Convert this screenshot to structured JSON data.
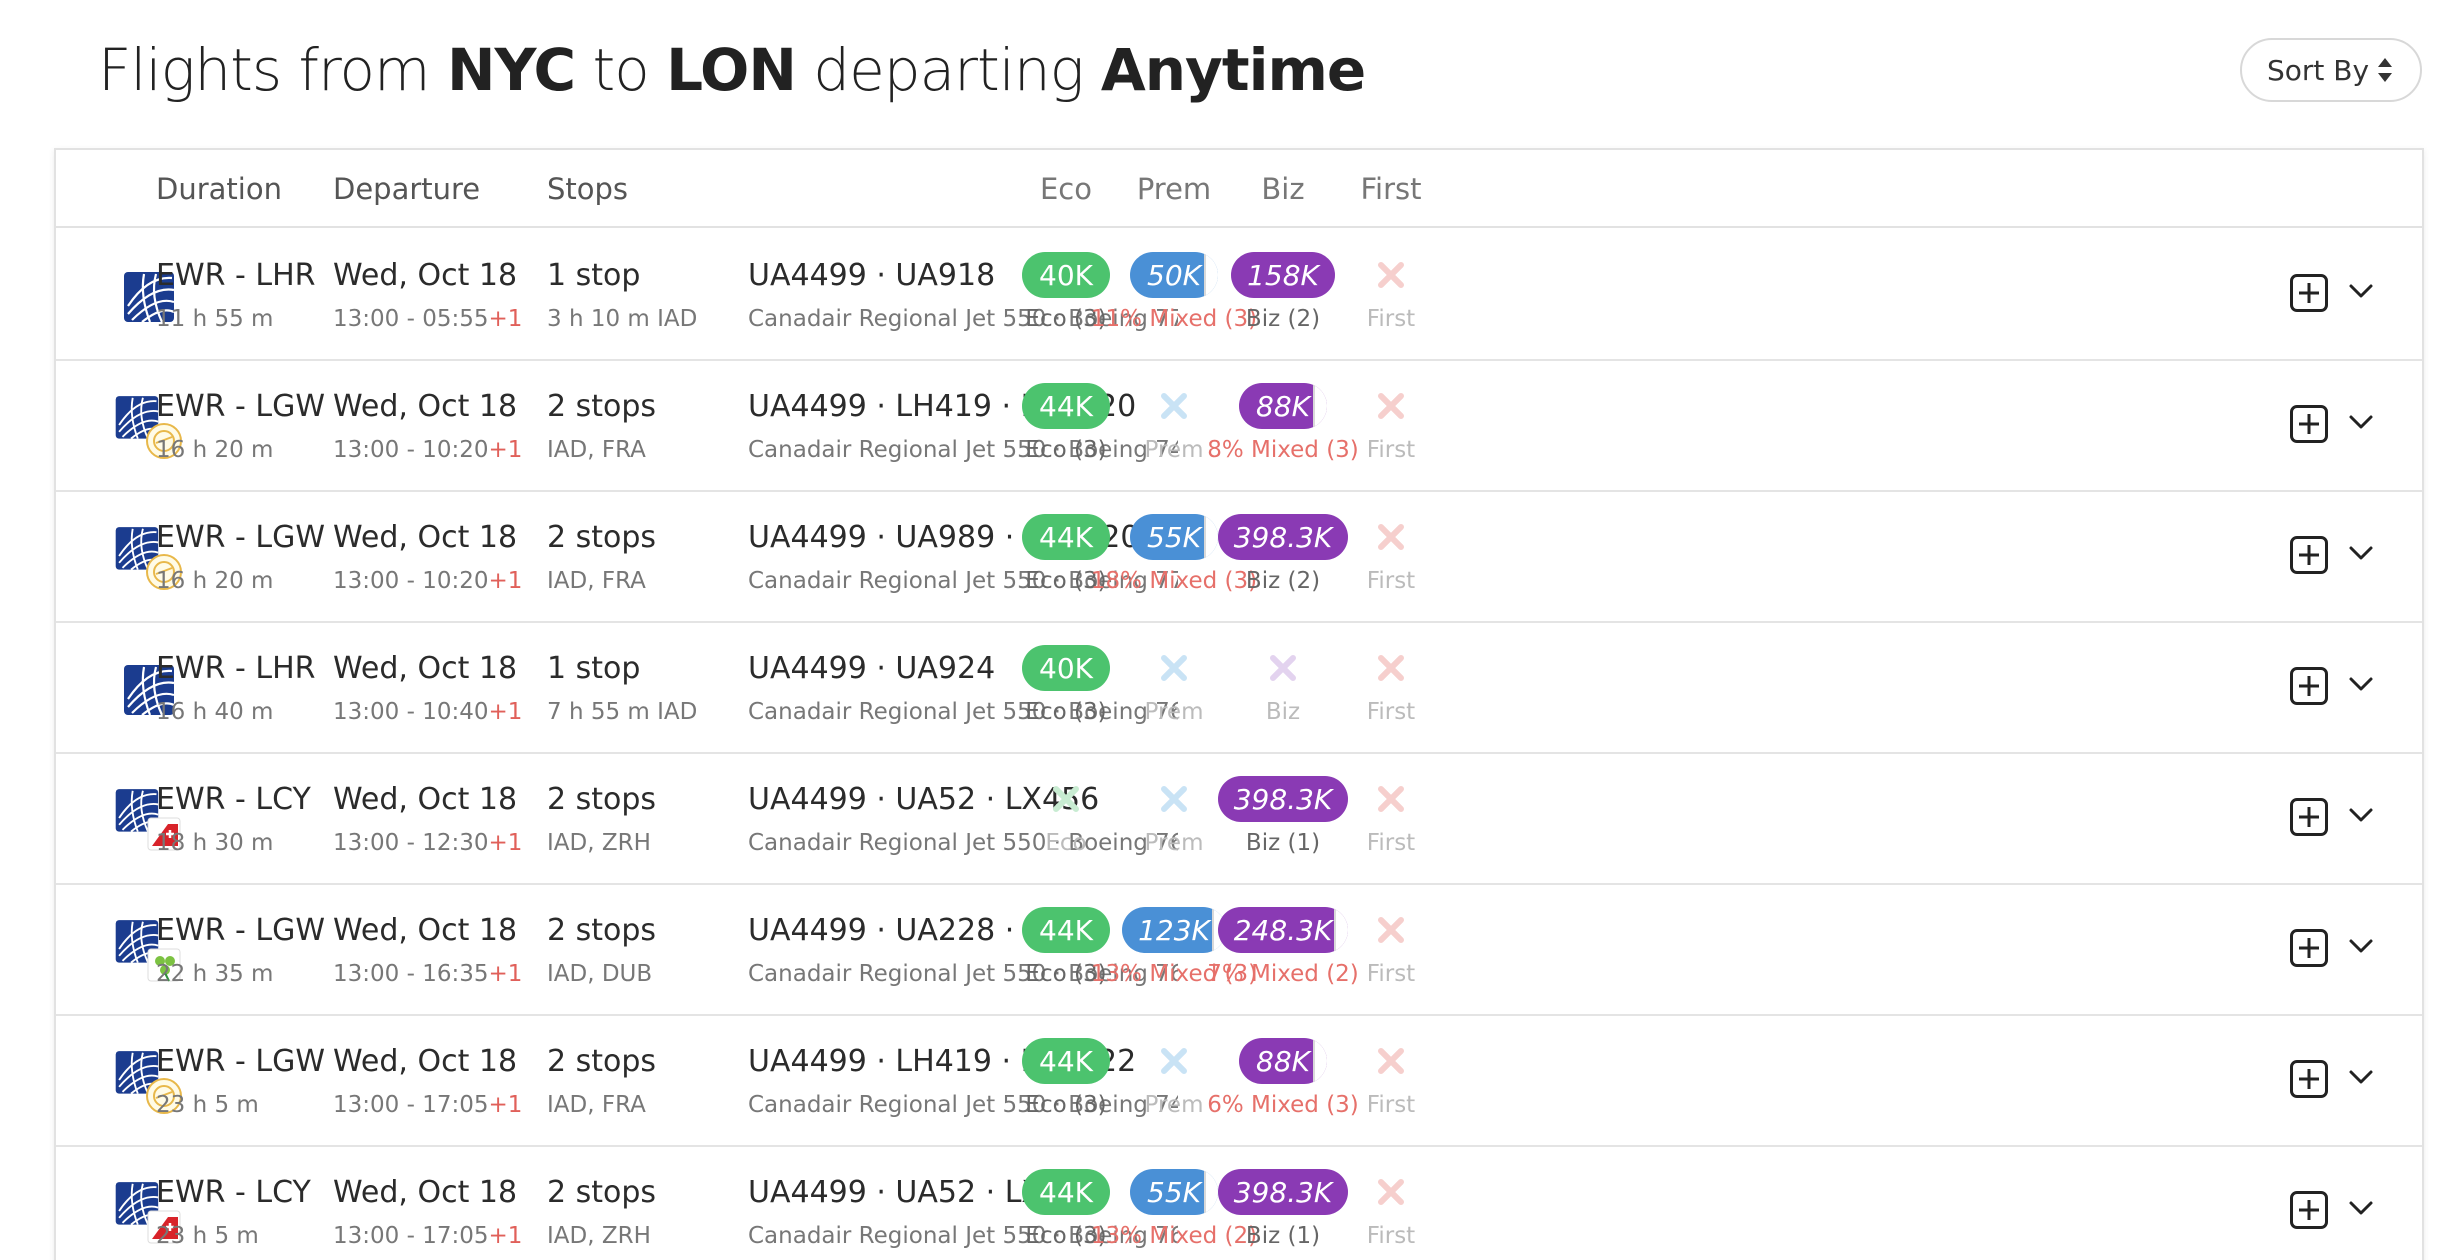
{
  "header": {
    "title_pre": "Flights from ",
    "origin": "NYC",
    "title_mid": " to ",
    "destination": "LON",
    "title_mid2": " departing ",
    "when": "Anytime",
    "sort_label": "Sort By"
  },
  "columns": {
    "duration": "Duration",
    "departure": "Departure",
    "stops": "Stops",
    "eco": "Eco",
    "prem": "Prem",
    "biz": "Biz",
    "first": "First"
  },
  "colors": {
    "eco": "#4cc36e",
    "prem": "#4a90d6",
    "biz": "#8a3ab4",
    "mixed_text": "#e6706a",
    "unavailable": "#b9dcf3"
  },
  "rows": [
    {
      "logo": "united-icon",
      "route": "EWR - LHR",
      "duration": "11 h 55 m",
      "date": "Wed, Oct 18",
      "times": "13:00 - 05:55",
      "day_offset": "+1",
      "stops": "1 stop",
      "stops_detail": "3 h 10 m  IAD",
      "flights": "UA4499  ·  UA918",
      "aircraft": "Canadair Regional Jet 550  ·  Boeing 777",
      "eco": {
        "value": "40K",
        "label": "Eco (3)"
      },
      "prem": {
        "value": "50K",
        "label": "11% Mixed (3)"
      },
      "biz": {
        "value": "158K",
        "label": "Biz (2)"
      },
      "first": {
        "label": "First"
      }
    },
    {
      "logo": "united-lufthansa-icon",
      "route": "EWR - LGW",
      "duration": "16 h 20 m",
      "date": "Wed, Oct 18",
      "times": "13:00 - 10:20",
      "day_offset": "+1",
      "stops": "2 stops",
      "stops_detail": "IAD, FRA",
      "flights": "UA4499  ·  LH419  ·  LH1520",
      "aircraft": "Canadair Regional Jet 550  ·  Boeing 747-8",
      "eco": {
        "value": "44K",
        "label": "Eco (3)"
      },
      "prem": {
        "label": "Prem"
      },
      "biz": {
        "value": "88K",
        "label": "8% Mixed (3)"
      },
      "first": {
        "label": "First"
      }
    },
    {
      "logo": "united-lufthansa-icon",
      "route": "EWR - LGW",
      "duration": "16 h 20 m",
      "date": "Wed, Oct 18",
      "times": "13:00 - 10:20",
      "day_offset": "+1",
      "stops": "2 stops",
      "stops_detail": "IAD, FRA",
      "flights": "UA4499  ·  UA989  ·  LH1520",
      "aircraft": "Canadair Regional Jet 550  ·  Boeing 777-300",
      "eco": {
        "value": "44K",
        "label": "Eco (3)"
      },
      "prem": {
        "value": "55K",
        "label": "18% Mixed (3)"
      },
      "biz": {
        "value": "398.3K",
        "label": "Biz (2)"
      },
      "first": {
        "label": "First"
      }
    },
    {
      "logo": "united-icon",
      "route": "EWR - LHR",
      "duration": "16 h 40 m",
      "date": "Wed, Oct 18",
      "times": "13:00 - 10:40",
      "day_offset": "+1",
      "stops": "1 stop",
      "stops_detail": "7 h 55 m  IAD",
      "flights": "UA4499  ·  UA924",
      "aircraft": "Canadair Regional Jet 550  ·  Boeing 767-300",
      "eco": {
        "value": "40K",
        "label": "Eco (3)"
      },
      "prem": {
        "label": "Prem"
      },
      "biz": {
        "label": "Biz"
      },
      "first": {
        "label": "First"
      }
    },
    {
      "logo": "united-swiss-icon",
      "route": "EWR - LCY",
      "duration": "18 h 30 m",
      "date": "Wed, Oct 18",
      "times": "13:00 - 12:30",
      "day_offset": "+1",
      "stops": "2 stops",
      "stops_detail": "IAD, ZRH",
      "flights": "UA4499  ·  UA52  ·  LX456",
      "aircraft": "Canadair Regional Jet 550  ·  Boeing 767-300",
      "eco": {
        "label": "Eco"
      },
      "prem": {
        "label": "Prem"
      },
      "biz": {
        "value": "398.3K",
        "label": "Biz (1)"
      },
      "first": {
        "label": "First"
      }
    },
    {
      "logo": "united-aerlingus-icon",
      "route": "EWR - LGW",
      "duration": "22 h 35 m",
      "date": "Wed, Oct 18",
      "times": "13:00 - 16:35",
      "day_offset": "+1",
      "stops": "2 stops",
      "stops_detail": "IAD, DUB",
      "flights": "UA4499  ·  UA228  ·  EI238",
      "aircraft": "Canadair Regional Jet 550  ·  Boeing 767-400",
      "eco": {
        "value": "44K",
        "label": "Eco (3)"
      },
      "prem": {
        "value": "123K",
        "label": "13% Mixed (3)"
      },
      "biz": {
        "value": "248.3K",
        "label": "7% Mixed (2)"
      },
      "first": {
        "label": "First"
      }
    },
    {
      "logo": "united-lufthansa-icon",
      "route": "EWR - LGW",
      "duration": "23 h 5 m",
      "date": "Wed, Oct 18",
      "times": "13:00 - 17:05",
      "day_offset": "+1",
      "stops": "2 stops",
      "stops_detail": "IAD, FRA",
      "flights": "UA4499  ·  LH419  ·  LH1522",
      "aircraft": "Canadair Regional Jet 550  ·  Boeing 747-8",
      "eco": {
        "value": "44K",
        "label": "Eco (3)"
      },
      "prem": {
        "label": "Prem"
      },
      "biz": {
        "value": "88K",
        "label": "6% Mixed (3)"
      },
      "first": {
        "label": "First"
      }
    },
    {
      "logo": "united-swiss-icon",
      "route": "EWR - LCY",
      "duration": "23 h 5 m",
      "date": "Wed, Oct 18",
      "times": "13:00 - 17:05",
      "day_offset": "+1",
      "stops": "2 stops",
      "stops_detail": "IAD, ZRH",
      "flights": "UA4499  ·  UA52  ·  LX464",
      "aircraft": "Canadair Regional Jet 550  ·  Boeing 767-300",
      "eco": {
        "value": "44K",
        "label": "Eco (3)"
      },
      "prem": {
        "value": "55K",
        "label": "13% Mixed (2)"
      },
      "biz": {
        "value": "398.3K",
        "label": "Biz (1)"
      },
      "first": {
        "label": "First"
      }
    }
  ]
}
